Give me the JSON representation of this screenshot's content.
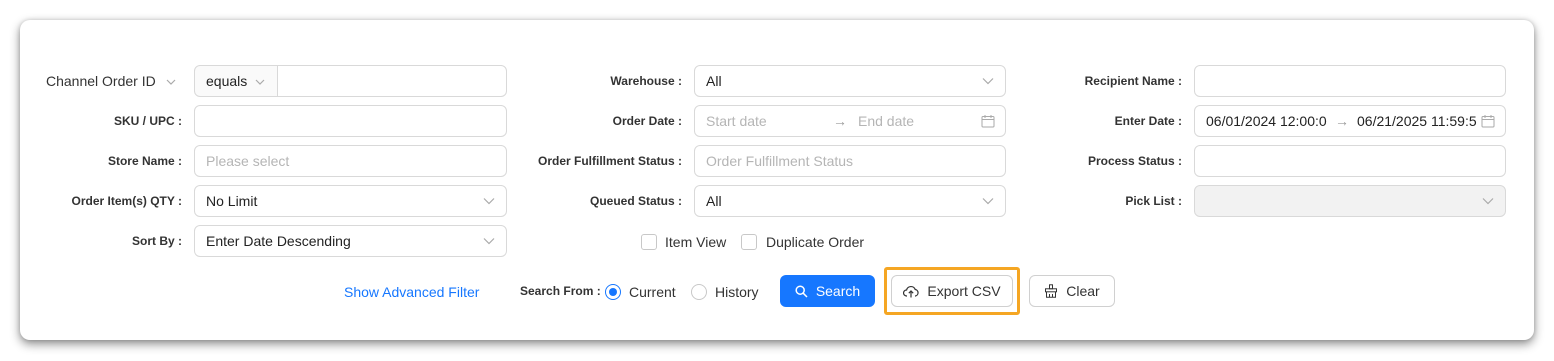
{
  "filters": {
    "channel_order_id": {
      "label": "Channel Order ID",
      "operator": "equals",
      "value": ""
    },
    "sku_upc": {
      "label": "SKU / UPC :",
      "value": ""
    },
    "store_name": {
      "label": "Store Name :",
      "placeholder": "Please select"
    },
    "order_item_qty": {
      "label": "Order Item(s) QTY :",
      "value": "No Limit"
    },
    "sort_by": {
      "label": "Sort By :",
      "value": "Enter Date Descending"
    },
    "warehouse": {
      "label": "Warehouse :",
      "value": "All"
    },
    "order_date": {
      "label": "Order Date :",
      "start_placeholder": "Start date",
      "end_placeholder": "End date"
    },
    "order_fulfillment_status": {
      "label": "Order Fulfillment Status :",
      "placeholder": "Order Fulfillment Status"
    },
    "queued_status": {
      "label": "Queued Status :",
      "value": "All"
    },
    "recipient_name": {
      "label": "Recipient Name :",
      "value": ""
    },
    "enter_date": {
      "label": "Enter Date :",
      "start": "06/01/2024 12:00:0",
      "end": "06/21/2025 11:59:5"
    },
    "process_status": {
      "label": "Process Status :",
      "value": ""
    },
    "pick_list": {
      "label": "Pick List :",
      "value": ""
    }
  },
  "options": {
    "item_view": "Item View",
    "duplicate_order": "Duplicate Order"
  },
  "actions": {
    "show_advanced_filter": "Show Advanced Filter",
    "search_from_label": "Search From :",
    "radio_current": "Current",
    "radio_history": "History",
    "search": "Search",
    "export_csv": "Export CSV",
    "clear": "Clear"
  },
  "colors": {
    "primary": "#1677ff",
    "highlight": "#f5a623"
  }
}
